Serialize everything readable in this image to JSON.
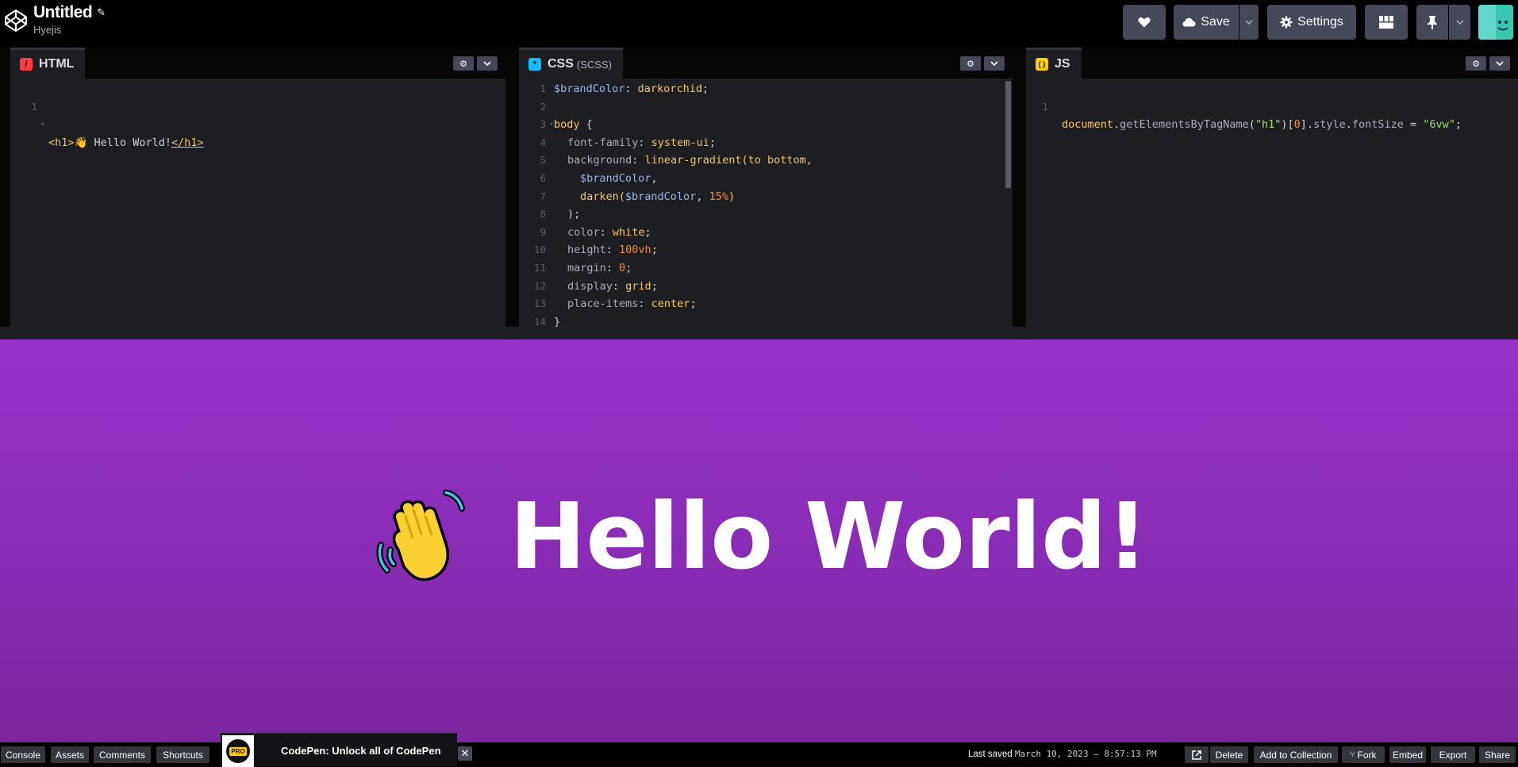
{
  "header": {
    "title": "Untitled",
    "owner": "Hyejis",
    "save_label": "Save",
    "settings_label": "Settings",
    "icons": [
      "codepen-logo-icon",
      "pencil-icon",
      "heart-icon",
      "cloud-icon",
      "chevron-down-icon",
      "gear-icon",
      "layout-icon",
      "pin-icon",
      "avatar"
    ]
  },
  "editors": {
    "html": {
      "tab_label": "HTML",
      "badge": "/",
      "badge_color": "#ff3c41",
      "lines": [
        {
          "n": "1",
          "text": ""
        }
      ],
      "line1_open": "<h1>",
      "line1_text": "👋 Hello World!",
      "line1_close": "</h1>"
    },
    "css": {
      "tab_label": "CSS",
      "tab_sub": "(SCSS)",
      "badge": "*",
      "badge_color": "#0ebeff",
      "line_numbers": [
        "1",
        "2",
        "3",
        "4",
        "5",
        "6",
        "7",
        "8",
        "9",
        "10",
        "11",
        "12",
        "13",
        "14"
      ],
      "tokens": {
        "l1_var": "$brandColor",
        "l1_colon": ": ",
        "l1_val": "darkorchid",
        "l1_semi": ";",
        "l3_sel": "body",
        "l3_brace": " {",
        "l4_prop": "font-family",
        "l4_val": "system-ui",
        "l5_prop": "background",
        "l5_val": "linear-gradient(to bottom,",
        "l6_var": "$brandColor",
        "l6_comma": ",",
        "l7_fn": "darken(",
        "l7_var": "$brandColor",
        "l7_comma": ", ",
        "l7_num": "15%",
        "l7_close": ")",
        "l8_text": ");",
        "l9_prop": "color",
        "l9_val": "white",
        "l10_prop": "height",
        "l10_num": "100vh",
        "l11_prop": "margin",
        "l11_num": "0",
        "l12_prop": "display",
        "l12_val": "grid",
        "l13_prop": "place-items",
        "l13_val": "center",
        "l14_text": "}",
        "colon": ": ",
        "semi": ";"
      }
    },
    "js": {
      "tab_label": "JS",
      "badge": "( )",
      "badge_color": "#fcd000",
      "line_number": "1",
      "tokens": {
        "obj": "document",
        "dot1": ".",
        "fn": "getElementsByTagName",
        "p1": "(",
        "str1": "\"h1\"",
        "p2": ")[",
        "num": "0",
        "p3": "].",
        "prop1": "style",
        "dot2": ".",
        "prop2": "fontSize",
        "eq": " = ",
        "str2": "\"6vw\"",
        "semi": ";"
      }
    }
  },
  "preview": {
    "heading": "Hello World!",
    "emoji": "👋",
    "gradient_top": "#9932cc",
    "gradient_bottom": "#7a279f"
  },
  "footer": {
    "console": "Console",
    "assets": "Assets",
    "comments": "Comments",
    "shortcuts": "Shortcuts",
    "promo_badge": "PRO",
    "promo_text": "CodePen: Unlock all of CodePen",
    "promo_close": "✕",
    "saved_label": "Last saved",
    "saved_time": "March 10, 2023 — 8:57:13 PM",
    "delete": "Delete",
    "add_to_collection": "Add to Collection",
    "fork": "Fork",
    "embed": "Embed",
    "export": "Export",
    "share": "Share"
  }
}
